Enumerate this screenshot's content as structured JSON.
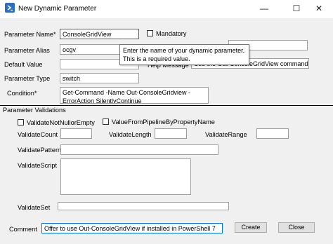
{
  "window": {
    "title": "New Dynamic Parameter",
    "minimize": "—",
    "maximize": "☐",
    "close": "✕",
    "icon": "powershell-icon",
    "accent_color": "#2c6fbf"
  },
  "form": {
    "parameter_name_label": "Parameter Name*",
    "parameter_name_value": "ConsoleGridView",
    "mandatory_label": "Mandatory",
    "parameter_alias_label": "Parameter Alias",
    "parameter_alias_value": "ocgv",
    "default_value_label": "Default Value",
    "default_value_value": "",
    "help_message_label": "Help Message",
    "help_message_value": "Use the Out-ConsoleGridView command",
    "parameter_type_label": "Parameter Type",
    "parameter_type_value": "switch",
    "condition_label": "Condition*",
    "condition_line1": "Get-Command -Name Out-ConsoleGridview -",
    "condition_line2": "ErrorAction SilentlyContinue"
  },
  "tooltip": {
    "line1": "Enter the name of your dynamic parameter.",
    "line2": "This is a required value."
  },
  "validations": {
    "section_label": "Parameter Validations",
    "not_null_or_empty_label": "ValidateNotNullorEmpty",
    "value_from_pipeline_label": "ValueFromPipelineByPropertyName",
    "count_label": "ValidateCount",
    "length_label": "ValidateLength",
    "range_label": "ValidateRange",
    "pattern_label": "ValidatePattern",
    "script_label": "ValidateScript",
    "set_label": "ValidateSet"
  },
  "footer": {
    "comment_label": "Comment",
    "comment_value": "Offer to use Out-ConsoleGridView if installed in PowerShell 7",
    "create_label": "Create",
    "close_label": "Close"
  }
}
